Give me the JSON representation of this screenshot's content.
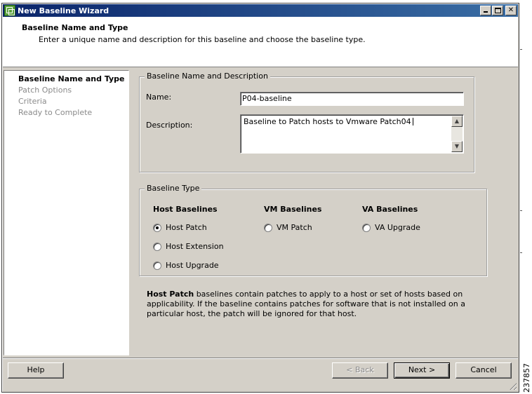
{
  "window": {
    "title": "New Baseline Wizard",
    "icon": "vmware-update-manager-icon",
    "controls": [
      "minimize-icon",
      "maximize-icon",
      "close-icon"
    ]
  },
  "header": {
    "title": "Baseline Name and Type",
    "subtitle": "Enter a unique name and description for this baseline and choose the baseline type."
  },
  "steps": [
    {
      "label": "Baseline Name and Type",
      "state": "active"
    },
    {
      "label": "Patch Options",
      "state": "inactive"
    },
    {
      "label": "Criteria",
      "state": "inactive"
    },
    {
      "label": "Ready to Complete",
      "state": "inactive"
    }
  ],
  "name_group": {
    "legend": "Baseline Name and Description",
    "name_label": "Name:",
    "name_value": "P04-baseline",
    "description_label": "Description:",
    "description_value": "Baseline to Patch hosts to Vmware Patch04"
  },
  "type_group": {
    "legend": "Baseline Type",
    "host_heading": "Host Baselines",
    "vm_heading": "VM Baselines",
    "va_heading": "VA Baselines",
    "host_patch": "Host Patch",
    "host_extension": "Host Extension",
    "host_upgrade": "Host Upgrade",
    "vm_patch": "VM Patch",
    "va_upgrade": "VA Upgrade",
    "selected": "Host Patch"
  },
  "info": {
    "bold": "Host Patch",
    "text": " baselines contain patches to apply to a host or set of hosts based on applicability. If the baseline contains patches for software that is not installed on a particular host, the patch will be ignored for that host."
  },
  "buttons": {
    "help": "Help",
    "back": "< Back",
    "next": "Next >",
    "cancel": "Cancel"
  },
  "side_number": "237857"
}
